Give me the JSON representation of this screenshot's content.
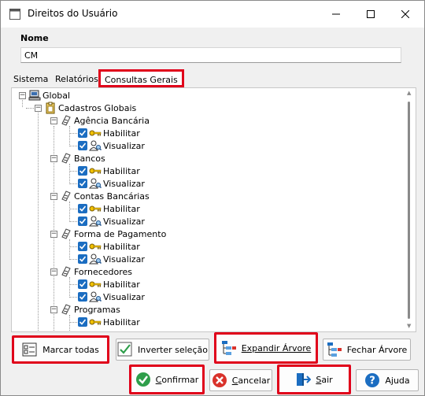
{
  "window": {
    "title": "Direitos do Usuário"
  },
  "form": {
    "name_label": "Nome",
    "name_value": "CM"
  },
  "tabs": [
    {
      "label": "Sistema",
      "active": false
    },
    {
      "label": "Relatórios",
      "active": false
    },
    {
      "label": "Consultas Gerais",
      "active": true
    }
  ],
  "tree": {
    "root": "Global",
    "group": "Cadastros Globais",
    "permission_labels": {
      "habilitar": "Habilitar",
      "visualizar": "Visualizar"
    },
    "items": [
      {
        "label": "Agência Bancária"
      },
      {
        "label": "Bancos"
      },
      {
        "label": "Contas Bancárias"
      },
      {
        "label": "Forma de Pagamento"
      },
      {
        "label": "Fornecedores"
      },
      {
        "label": "Programas"
      }
    ]
  },
  "toolbar": {
    "marcar_todas": "Marcar todas",
    "inverter_selecao": "Inverter seleção",
    "expandir_arvore": "Expandir Árvore",
    "fechar_arvore": "Fechar Árvore"
  },
  "footer": {
    "confirmar": "Confirmar",
    "cancelar": "Cancelar",
    "sair": "Sair",
    "ajuda": "Ajuda"
  },
  "colors": {
    "highlight": "#e0001a",
    "checkbox": "#1b6dc1",
    "confirm_green": "#2e9e4a",
    "cancel_red": "#d9322b",
    "help_blue": "#1b6dc1"
  }
}
